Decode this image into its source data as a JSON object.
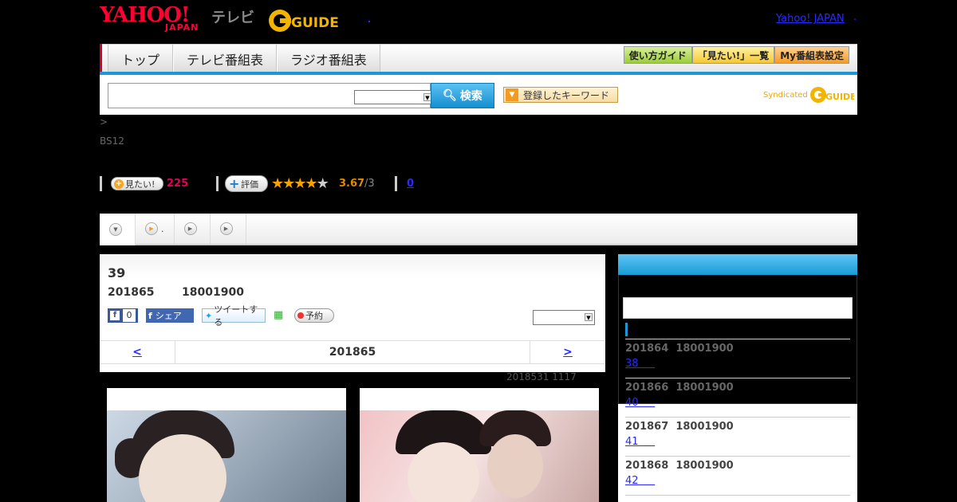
{
  "header": {
    "logo_yahoo": "YAHOO!",
    "logo_japan": "JAPAN",
    "logo_tv": "テレビ",
    "logo_gguide": "G-GUIDE",
    "yahoo_japan_link": "Yahoo! JAPAN",
    "yahoo_japan_link_suffix": "."
  },
  "nav": {
    "tabs": [
      "トップ",
      "テレビ番組表",
      "ラジオ番組表"
    ],
    "guide_buttons": [
      "使い方ガイド",
      "「見たい!」一覧",
      "My番組表設定"
    ]
  },
  "search": {
    "value": "",
    "select_value": "",
    "button_label": "検索",
    "keyword_button_label": "登録したキーワード",
    "syndicated_label": "Syndicated",
    "syndicated_logo": "G-GUIDE"
  },
  "breadcrumb": ">",
  "channel": "BS12",
  "stats": {
    "want_label": "見たい!",
    "want_count": "225",
    "rate_label": "評価",
    "rating_value": 3.67,
    "rating_text": "3.67",
    "rating_sub": "/3",
    "zero_link": "0"
  },
  "subtabs": [
    {
      "label": "",
      "icon": "chevron-down-icon"
    },
    {
      "label": ".",
      "icon": "play-icon"
    },
    {
      "label": "",
      "icon": "play-icon"
    },
    {
      "label": "",
      "icon": "play-icon"
    }
  ],
  "episode": {
    "title": "39",
    "date": "201865",
    "time": "18001900",
    "fb_like_count": "0",
    "fb_share_label": "シェア",
    "tweet_label": "ツイートする",
    "reserve_label": "予約",
    "select_value": ""
  },
  "pager": {
    "prev": "<",
    "current": "201865",
    "next": ">"
  },
  "updated": "2018531  1117",
  "sidebar": {
    "items": [
      {
        "date": "201864",
        "time": "18001900",
        "ep": "38"
      },
      {
        "date": "201866",
        "time": "18001900",
        "ep": "40"
      },
      {
        "date": "201867",
        "time": "18001900",
        "ep": "41"
      },
      {
        "date": "201868",
        "time": "18001900",
        "ep": "42"
      }
    ]
  },
  "colors": {
    "accent_blue": "#1e96d8",
    "yahoo_red": "#ff0033",
    "want_pink": "#e5005a",
    "rating_orange": "#e08a00",
    "link_blue": "#2a2aff"
  }
}
